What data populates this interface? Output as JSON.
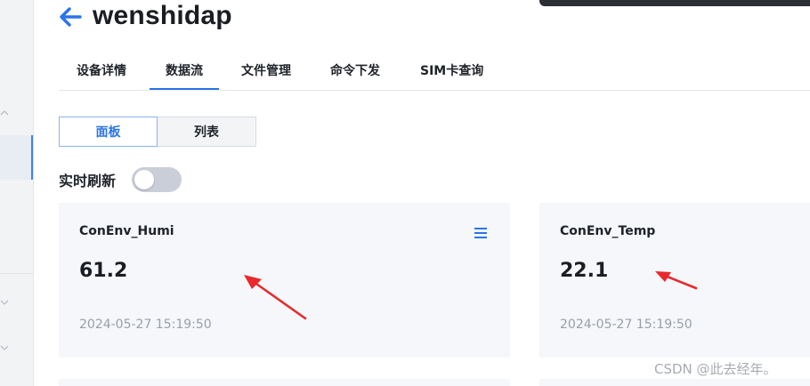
{
  "header": {
    "title": "wenshidap"
  },
  "tabs": [
    {
      "label": "设备详情"
    },
    {
      "label": "数据流"
    },
    {
      "label": "文件管理"
    },
    {
      "label": "命令下发"
    },
    {
      "label": "SIM卡查询"
    }
  ],
  "active_tab": "数据流",
  "view_toggle": {
    "panel": "面板",
    "list": "列表",
    "selected": "面板"
  },
  "realtime": {
    "label": "实时刷新",
    "enabled": false
  },
  "cards": [
    {
      "name": "ConEnv_Humi",
      "value": "61.2",
      "time": "2024-05-27 15:19:50"
    },
    {
      "name": "ConEnv_Temp",
      "value": "22.1",
      "time": "2024-05-27 15:19:50"
    }
  ],
  "watermark": "CSDN @此去经年。",
  "colors": {
    "accent": "#2a74e8",
    "annotation": "#e8282b",
    "card_bg": "#f5f7fa"
  }
}
